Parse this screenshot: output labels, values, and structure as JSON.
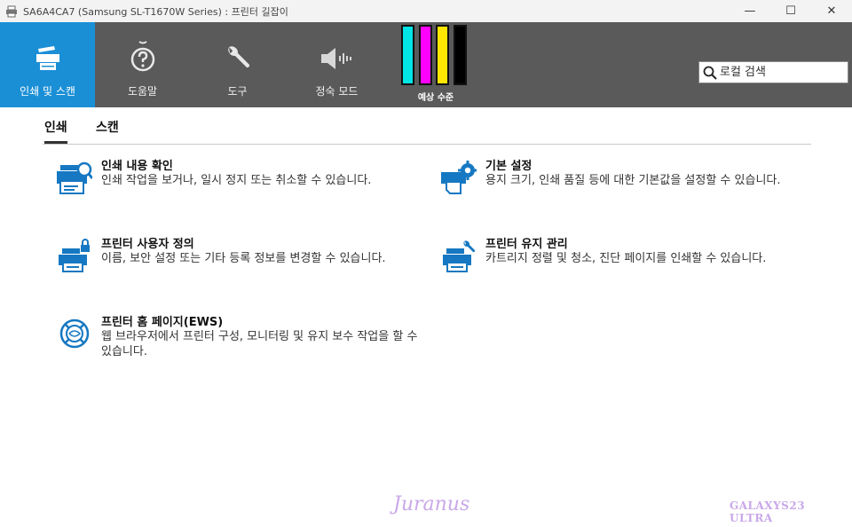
{
  "window": {
    "title": "SA6A4CA7 (Samsung SL-T1670W Series) : 프린터 길잡이",
    "minimize": "—",
    "maximize": "☐",
    "close": "✕"
  },
  "nav": {
    "items": [
      {
        "label": "인쇄 및 스캔",
        "icon": "printer-scan-icon",
        "active": true
      },
      {
        "label": "도움말",
        "icon": "help-icon",
        "active": false
      },
      {
        "label": "도구",
        "icon": "wrench-icon",
        "active": false
      },
      {
        "label": "정숙 모드",
        "icon": "speaker-icon",
        "active": false
      }
    ],
    "ink": {
      "label": "예상 수준",
      "colors": [
        "#00e5e5",
        "#ff00ff",
        "#ffe600",
        "#000000"
      ],
      "levels": [
        1.0,
        1.0,
        1.0,
        1.0
      ]
    },
    "search": {
      "placeholder": "로컬 검색"
    }
  },
  "tabs": [
    {
      "label": "인쇄",
      "active": true
    },
    {
      "label": "스캔",
      "active": false
    }
  ],
  "cards": [
    {
      "title": "인쇄 내용 확인",
      "desc": "인쇄 작업을 보거나, 일시 정지 또는 취소할 수 있습니다.",
      "icon": "print-queue-icon"
    },
    {
      "title": "기본 설정",
      "desc": "용지 크기, 인쇄 품질 등에 대한 기본값을 설정할 수 있습니다.",
      "icon": "printer-settings-icon"
    },
    {
      "title": "프린터 사용자 정의",
      "desc": "이름, 보안 설정 또는 기타 등록 정보를 변경할 수 있습니다.",
      "icon": "printer-lock-icon"
    },
    {
      "title": "프린터 유지 관리",
      "desc": "카트리지 정렬 및 청소, 진단 페이지를 인쇄할 수 있습니다.",
      "icon": "printer-maintenance-icon"
    },
    {
      "title": "프린터 홈 페이지(EWS)",
      "desc": "웹 브라우저에서 프린터 구성, 모니터링 및 유지 보수 작업을 할 수 있습니다.",
      "icon": "web-globe-icon"
    }
  ],
  "watermark": {
    "left": "Juranus",
    "right": "GALAXYS23 ULTRA"
  },
  "colors": {
    "accent": "#1b8fd6",
    "topbar": "#5a5a5a",
    "icon_blue": "#1678c2"
  }
}
